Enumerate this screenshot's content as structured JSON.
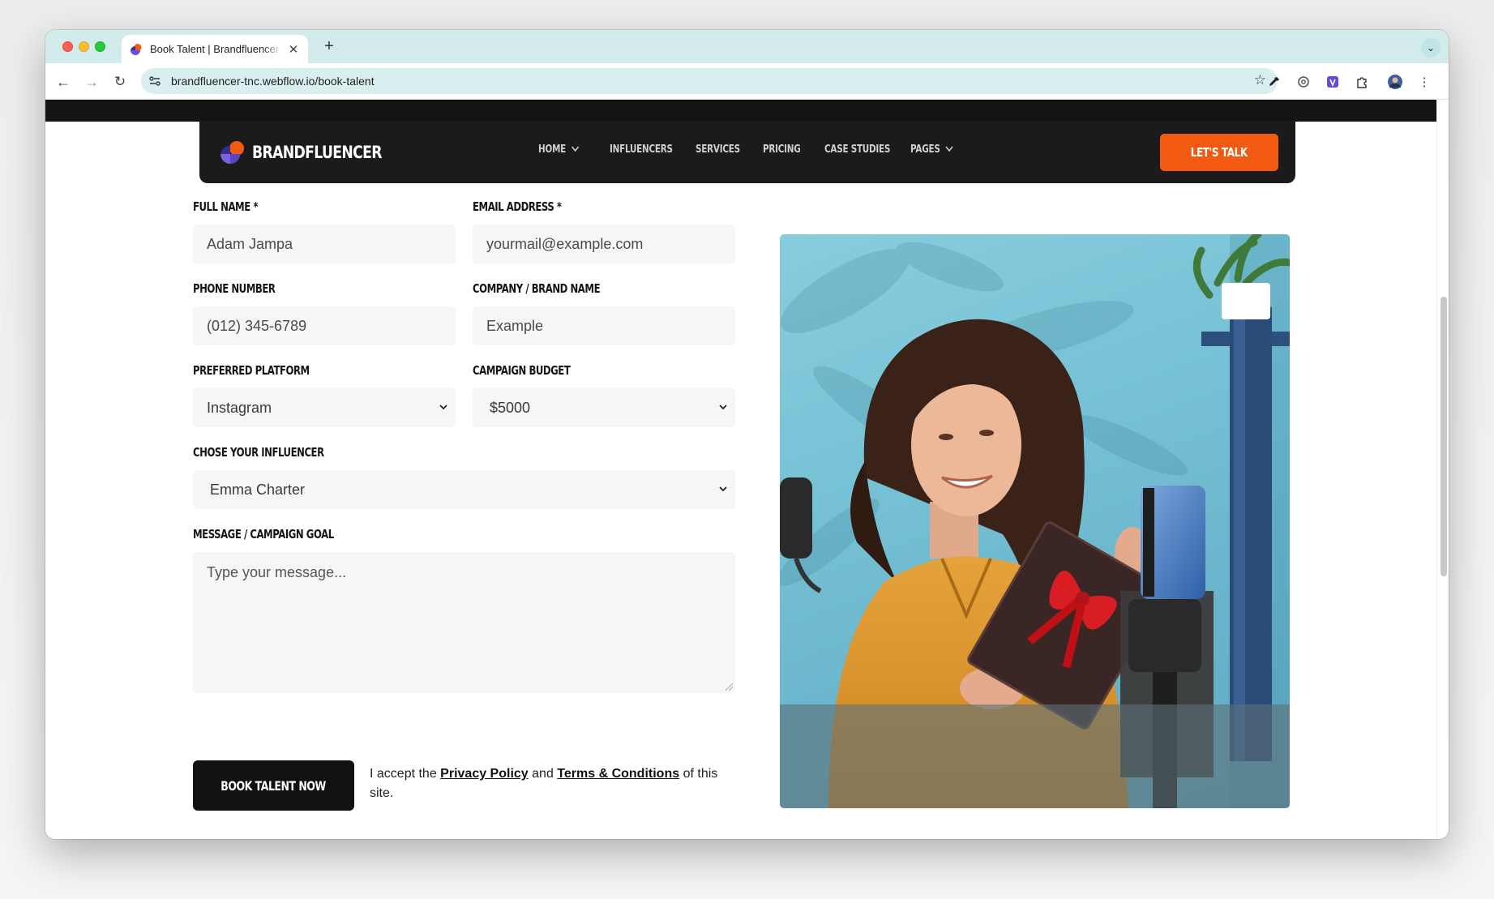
{
  "browser": {
    "tab_title": "Book Talent | Brandfluencer",
    "url": "brandfluencer-tnc.webflow.io/book-talent"
  },
  "nav": {
    "brand": "BRANDFLUENCER",
    "items": [
      {
        "label": "HOME",
        "has_dropdown": true
      },
      {
        "label": "INFLUENCERS",
        "has_dropdown": false
      },
      {
        "label": "SERVICES",
        "has_dropdown": false
      },
      {
        "label": "PRICING",
        "has_dropdown": false
      },
      {
        "label": "CASE STUDIES",
        "has_dropdown": false
      },
      {
        "label": "PAGES",
        "has_dropdown": true
      }
    ],
    "cta": "LET'S TALK"
  },
  "form": {
    "full_name": {
      "label": "FULL NAME *",
      "placeholder": "Adam Jampa"
    },
    "email": {
      "label": "EMAIL ADDRESS *",
      "placeholder": "yourmail@example.com"
    },
    "phone": {
      "label": "PHONE NUMBER",
      "placeholder": "(012) 345-6789"
    },
    "company": {
      "label": "COMPANY / BRAND NAME",
      "placeholder": "Example"
    },
    "platform": {
      "label": "PREFERRED PLATFORM",
      "value": "Instagram"
    },
    "budget": {
      "label": "CAMPAIGN BUDGET",
      "value": "$5000"
    },
    "influencer": {
      "label": "CHOSE YOUR INFLUENCER",
      "value": "Emma Charter"
    },
    "message": {
      "label": "MESSAGE / CAMPAIGN GOAL",
      "placeholder": "Type your message..."
    },
    "submit": "BOOK TALENT NOW",
    "consent": {
      "prefix": "I accept the",
      "privacy": "Privacy Policy",
      "and": "and",
      "terms": "Terms & Conditions",
      "suffix": "of this site."
    }
  },
  "colors": {
    "accent": "#f25a12",
    "nav_bg": "#1b1b1b",
    "field_bg": "#f6f6f6",
    "button_dark": "#111111",
    "tabstrip": "#d4ebeb"
  }
}
